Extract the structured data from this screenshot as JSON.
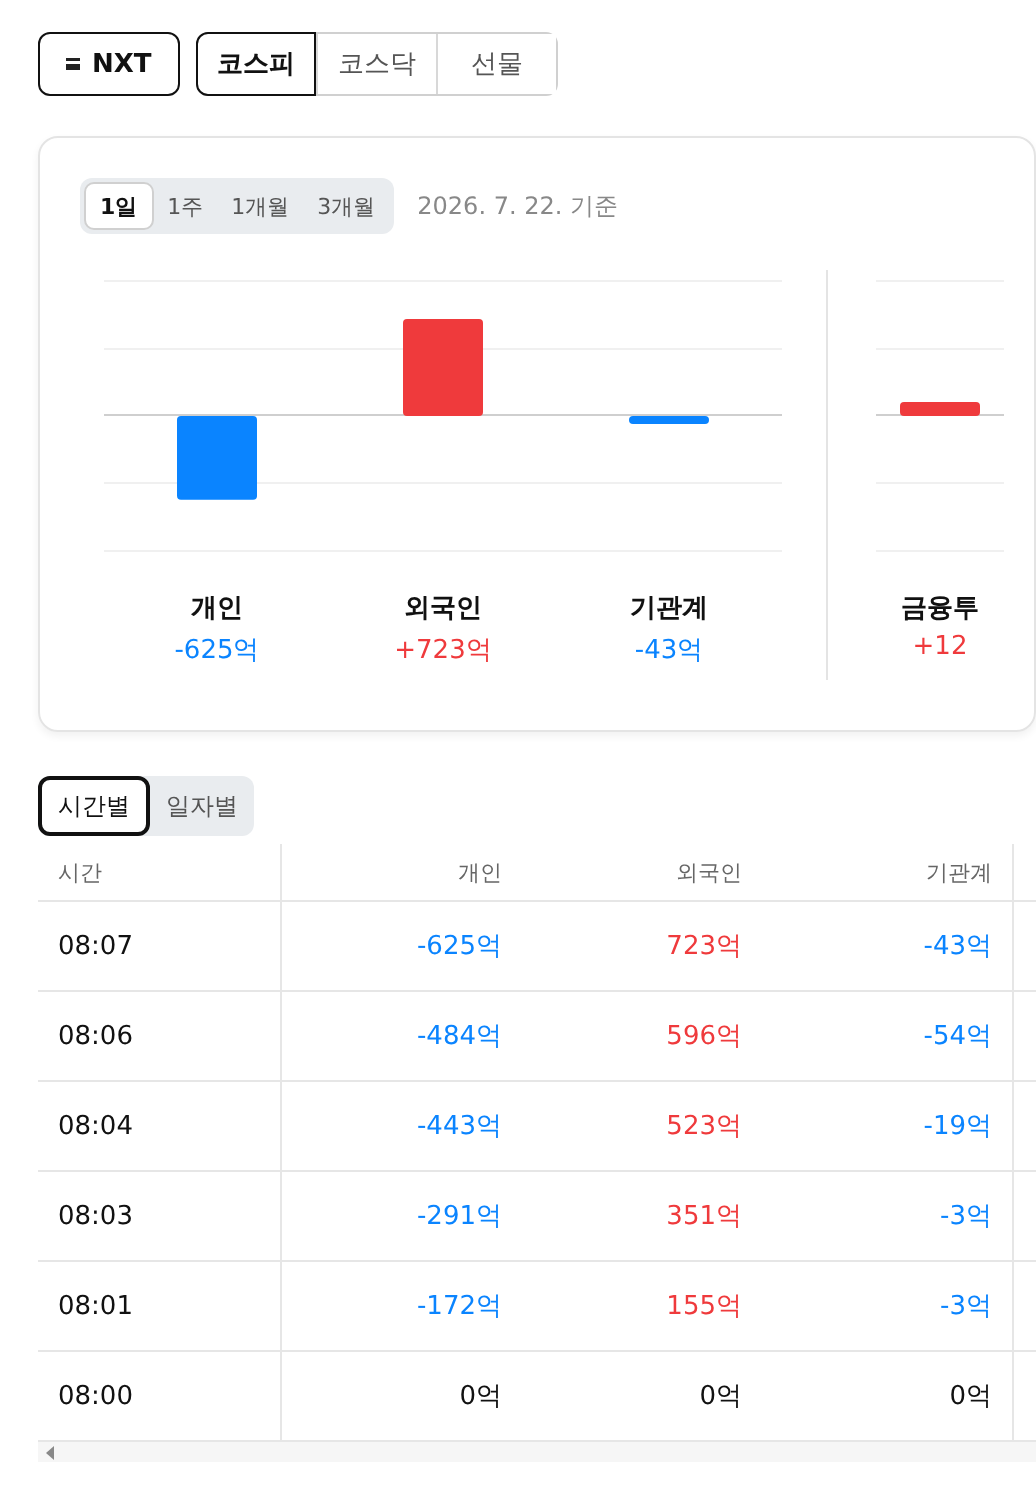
{
  "exchange_button": {
    "label": "NXT"
  },
  "market_tabs": [
    {
      "label": "코스피",
      "selected": true
    },
    {
      "label": "코스닥",
      "selected": false
    },
    {
      "label": "선물",
      "selected": false
    }
  ],
  "period_tabs": [
    {
      "label": "1일",
      "selected": true
    },
    {
      "label": "1주",
      "selected": false
    },
    {
      "label": "1개월",
      "selected": false
    },
    {
      "label": "3개월",
      "selected": false
    }
  ],
  "as_of": "2026. 7. 22. 기준",
  "summary_chart": {
    "chart_data": {
      "type": "bar",
      "categories": [
        "개인",
        "외국인",
        "기관계"
      ],
      "values": [
        -625,
        723,
        -43
      ],
      "value_labels": [
        "-625억",
        "+723억",
        "-43억"
      ]
    }
  },
  "extra_summary": [
    {
      "name": "금융투",
      "amount": "+12",
      "color": "#ef3a3c"
    }
  ],
  "view_tabs": [
    {
      "label": "시간별",
      "selected": true
    },
    {
      "label": "일자별",
      "selected": false
    }
  ],
  "table": {
    "columns": [
      "시간",
      "개인",
      "외국인",
      "기관계"
    ],
    "rows": [
      {
        "time": "08:07",
        "values": [
          {
            "text": "-625억",
            "color": "#0a84ff"
          },
          {
            "text": "723억",
            "color": "#ef3a3c"
          },
          {
            "text": "-43억",
            "color": "#0a84ff"
          }
        ]
      },
      {
        "time": "08:06",
        "values": [
          {
            "text": "-484억",
            "color": "#0a84ff"
          },
          {
            "text": "596억",
            "color": "#ef3a3c"
          },
          {
            "text": "-54억",
            "color": "#0a84ff"
          }
        ]
      },
      {
        "time": "08:04",
        "values": [
          {
            "text": "-443억",
            "color": "#0a84ff"
          },
          {
            "text": "523억",
            "color": "#ef3a3c"
          },
          {
            "text": "-19억",
            "color": "#0a84ff"
          }
        ]
      },
      {
        "time": "08:03",
        "values": [
          {
            "text": "-291억",
            "color": "#0a84ff"
          },
          {
            "text": "351억",
            "color": "#ef3a3c"
          },
          {
            "text": "-3억",
            "color": "#0a84ff"
          }
        ]
      },
      {
        "time": "08:01",
        "values": [
          {
            "text": "-172억",
            "color": "#0a84ff"
          },
          {
            "text": "155억",
            "color": "#ef3a3c"
          },
          {
            "text": "-3억",
            "color": "#0a84ff"
          }
        ]
      },
      {
        "time": "08:00",
        "values": [
          {
            "text": "0억",
            "color": "#111111"
          },
          {
            "text": "0억",
            "color": "#111111"
          },
          {
            "text": "0억",
            "color": "#111111"
          }
        ]
      }
    ]
  }
}
